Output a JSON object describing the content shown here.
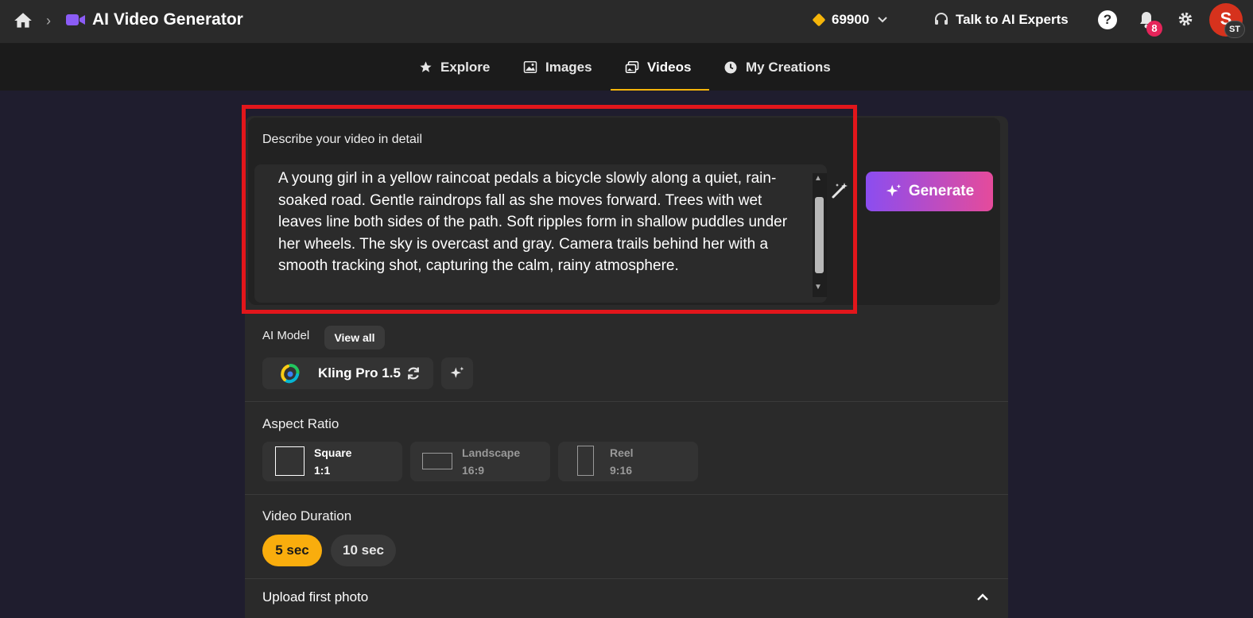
{
  "header": {
    "app_title": "AI Video Generator",
    "credits": "69900",
    "talk_label": "Talk to AI Experts",
    "help_label": "?",
    "notifications_count": "8",
    "avatar_initial": "S",
    "avatar_badge": "ST"
  },
  "nav": {
    "tabs": [
      {
        "label": "Explore",
        "icon": "star-icon"
      },
      {
        "label": "Images",
        "icon": "image-icon"
      },
      {
        "label": "Videos",
        "icon": "gallery-icon",
        "active": true
      },
      {
        "label": "My Creations",
        "icon": "clock-icon"
      }
    ]
  },
  "prompt": {
    "label": "Describe your video in detail",
    "text": "A young girl in a yellow raincoat pedals a bicycle slowly along a quiet, rain-soaked road. Gentle raindrops fall as she moves forward. Trees with wet leaves line both sides of the path. Soft ripples form in shallow puddles under her wheels. The sky is overcast and gray. Camera trails behind her with a smooth tracking shot, capturing the calm, rainy atmosphere.",
    "generate_label": "Generate"
  },
  "model": {
    "label": "AI Model",
    "view_all": "View all",
    "selected": "Kling Pro 1.5"
  },
  "aspect": {
    "label": "Aspect Ratio",
    "options": [
      {
        "name": "Square",
        "ratio": "1:1",
        "active": true
      },
      {
        "name": "Landscape",
        "ratio": "16:9",
        "active": false
      },
      {
        "name": "Reel",
        "ratio": "9:16",
        "active": false
      }
    ]
  },
  "duration": {
    "label": "Video Duration",
    "options": [
      {
        "label": "5 sec",
        "active": true
      },
      {
        "label": "10 sec",
        "active": false
      }
    ]
  },
  "upload": {
    "label": "Upload first photo"
  },
  "colors": {
    "accent": "#f9ad0d",
    "highlight": "#e2161b",
    "generate_start": "#8b4df0",
    "generate_end": "#e54b9b"
  }
}
